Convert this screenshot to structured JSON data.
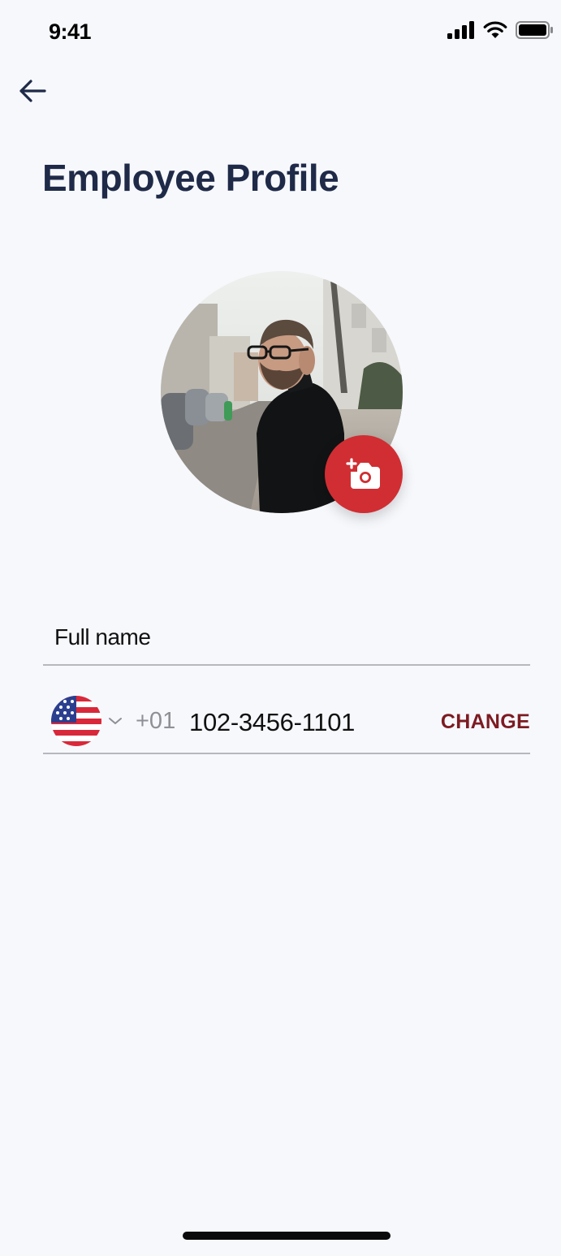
{
  "status_bar": {
    "time": "9:41",
    "icons": [
      "cellular-signal-icon",
      "wifi-icon",
      "battery-icon"
    ]
  },
  "header": {
    "back_icon": "arrow-left-icon",
    "title": "Employee Profile"
  },
  "profile": {
    "photo_description": "man in black turtleneck and glasses on a street",
    "camera_icon": "add-photo-camera-icon",
    "accent_color": "#d02e33"
  },
  "form": {
    "full_name": {
      "placeholder": "Full name",
      "value": ""
    },
    "phone": {
      "country_flag_icon": "us-flag-icon",
      "dropdown_icon": "chevron-down-icon",
      "dial_code": "+01",
      "number": "102-3456-1101",
      "change_label": "CHANGE",
      "change_color": "#7d1b22"
    }
  },
  "colors": {
    "background": "#f6f8fc",
    "title": "#1f2a48",
    "divider": "#b7b8be"
  }
}
